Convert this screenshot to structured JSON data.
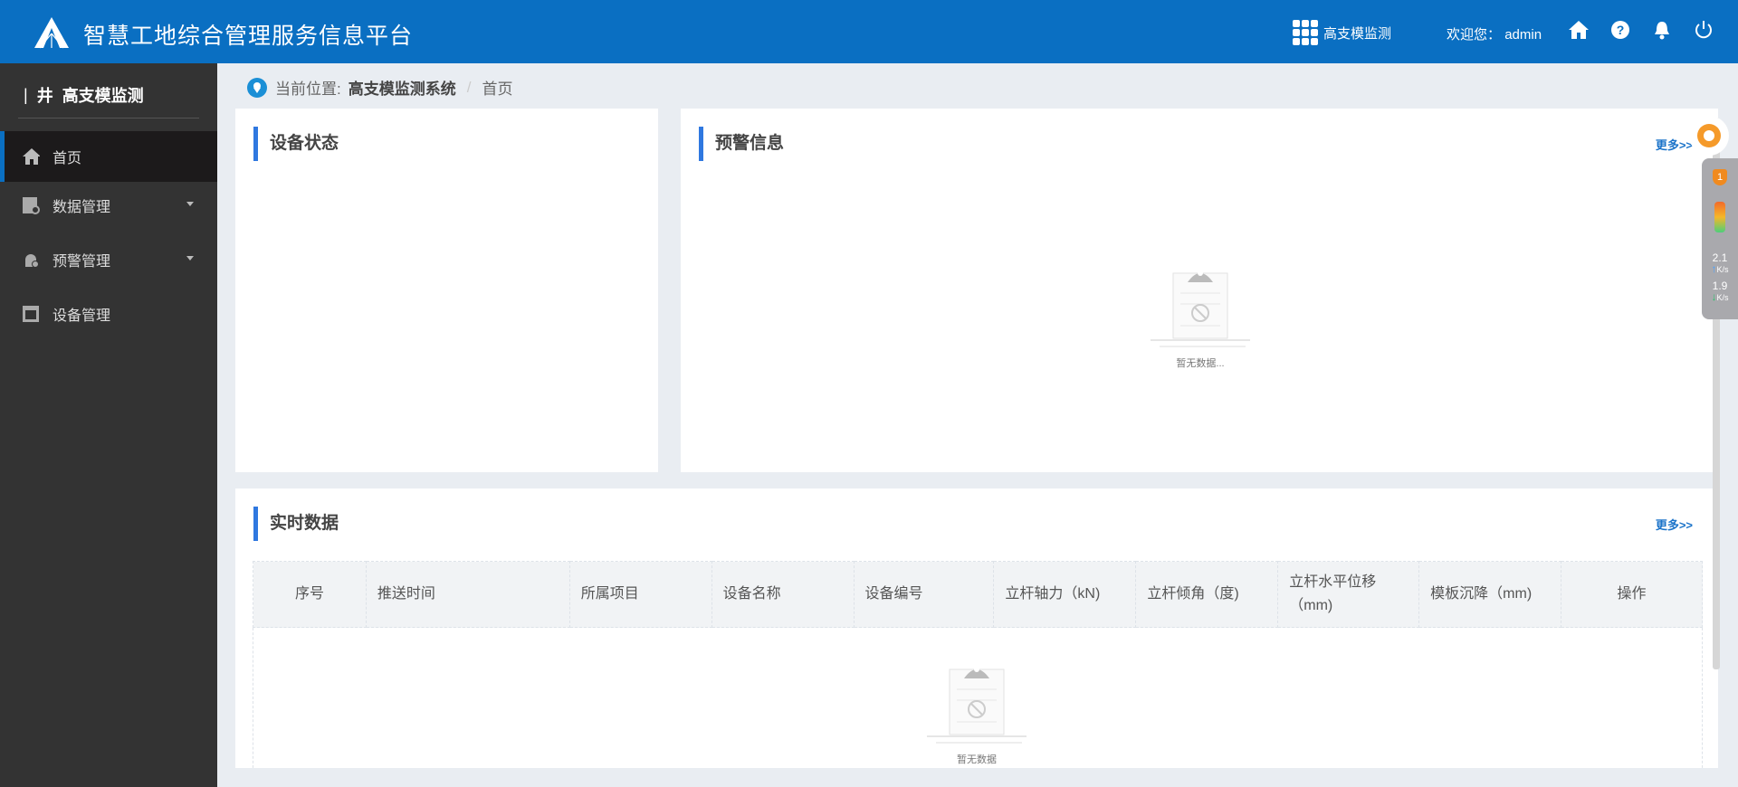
{
  "header": {
    "title": "智慧工地综合管理服务信息平台",
    "system": "高支模监测",
    "welcome": "欢迎您：",
    "user": "admin",
    "icons": [
      "home-icon",
      "help-icon",
      "bell-icon",
      "power-icon"
    ],
    "color": "#0a6fc2"
  },
  "sidebar": {
    "title": "高支模监测",
    "items": [
      {
        "label": "首页",
        "icon": "home-icon",
        "active": true
      },
      {
        "label": "数据管理",
        "icon": "data-icon",
        "expandable": true
      },
      {
        "label": "预警管理",
        "icon": "alarm-icon",
        "expandable": true
      },
      {
        "label": "设备管理",
        "icon": "device-icon"
      }
    ]
  },
  "breadcrumb": {
    "prefix": "当前位置:",
    "system": "高支模监测系统",
    "sep": "/",
    "page": "首页"
  },
  "device_status": {
    "title": "设备状态"
  },
  "alerts": {
    "title": "预警信息",
    "more": "更多>>",
    "empty": "暂无数据..."
  },
  "realtime": {
    "title": "实时数据",
    "more": "更多>>",
    "empty": "暂无数据",
    "columns": [
      "序号",
      "推送时间",
      "所属项目",
      "设备名称",
      "设备编号",
      "立杆轴力（kN)",
      "立杆倾角（度)",
      "立杆水平位移（mm)",
      "模板沉降（mm)",
      "操作"
    ]
  },
  "widget": {
    "badge": "1",
    "up": "2.1",
    "down": "1.9",
    "unit": "K/s"
  }
}
